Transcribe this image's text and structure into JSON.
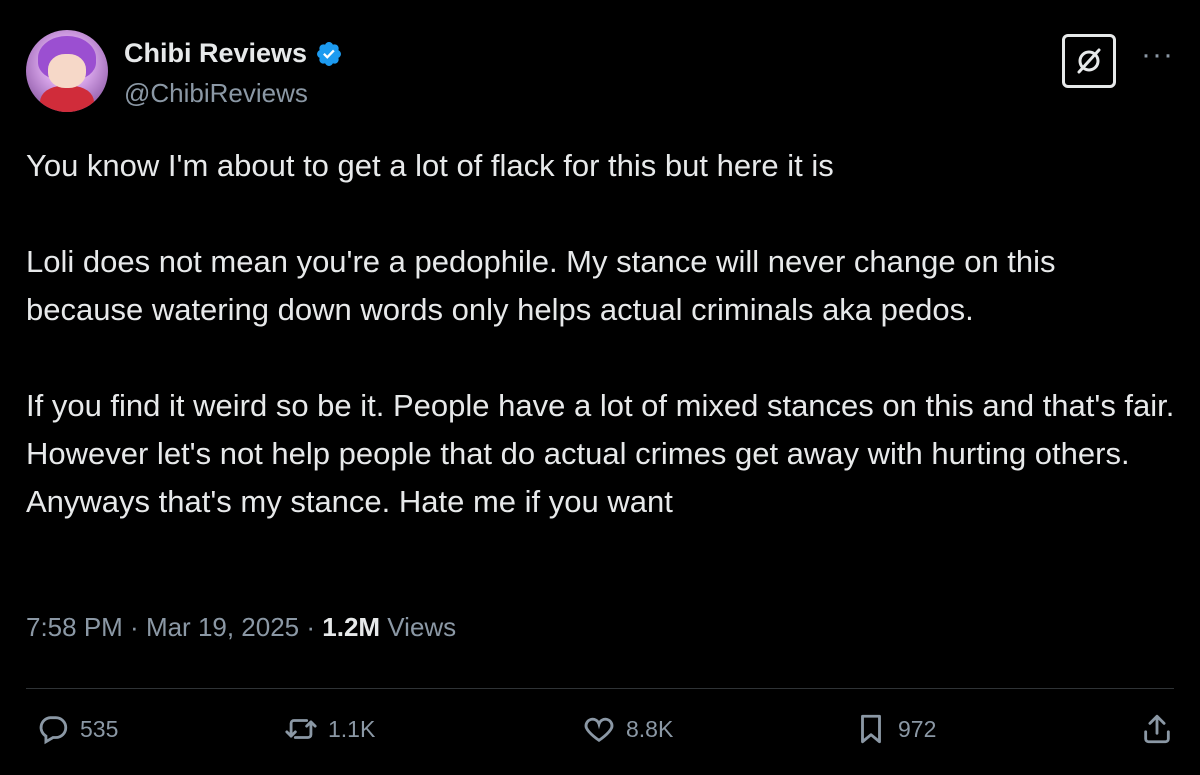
{
  "author": {
    "display_name": "Chibi Reviews",
    "handle": "@ChibiReviews",
    "verified_icon": "verified-badge-icon",
    "verified_color": "#1d9bf0"
  },
  "header_actions": {
    "grok_icon": "grok-icon",
    "more_label": "···"
  },
  "tweet": {
    "text": "You know I'm about to get a lot of flack for this but here it is\n\nLoli does not mean you're a pedophile. My stance will never change on this because watering down words only helps actual criminals aka pedos.\n\nIf you find it weird so be it. People have a lot of mixed stances on this and that's fair. However let's not help people that do actual crimes get away with hurting others. Anyways that's my stance. Hate me if you want",
    "time": "7:58 PM",
    "date": "Mar 19, 2025",
    "separator": " · ",
    "views_count": "1.2M",
    "views_label": " Views"
  },
  "actions": {
    "replies": "535",
    "reposts": "1.1K",
    "likes": "8.8K",
    "bookmarks": "972"
  },
  "colors": {
    "background": "#000000",
    "text": "#e7e9ea",
    "secondary": "#8b98a5",
    "divider": "#2f3336"
  }
}
